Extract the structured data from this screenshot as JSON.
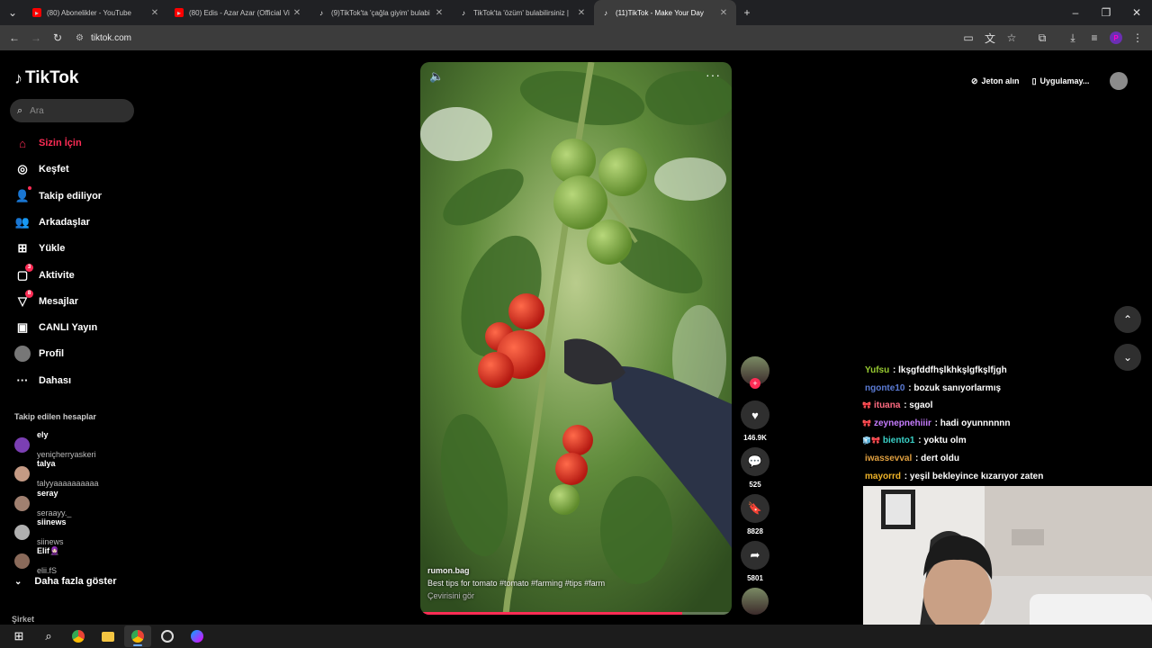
{
  "browser": {
    "tabs": [
      {
        "title": "(80) Abonelikler - YouTube",
        "icon": "youtube-icon",
        "active": false
      },
      {
        "title": "(80) Edis - Azar Azar (Official Vi",
        "icon": "youtube-icon",
        "active": false
      },
      {
        "title": "(9)TikTok'ta 'çağla giyim' bulabi",
        "icon": "tiktok-icon",
        "active": false
      },
      {
        "title": "TikTok'ta 'özüm' bulabilirsiniz |",
        "icon": "tiktok-icon",
        "active": false
      },
      {
        "title": "(11)TikTok - Make Your Day",
        "icon": "tiktok-icon",
        "active": true
      }
    ],
    "url": "tiktok.com",
    "profile_initial": "P"
  },
  "sidebar": {
    "logo": "TikTok",
    "search_placeholder": "Ara",
    "nav": [
      {
        "label": "Sizin İçin",
        "icon": "home-icon",
        "active": true
      },
      {
        "label": "Keşfet",
        "icon": "compass-icon"
      },
      {
        "label": "Takip ediliyor",
        "icon": "following-icon"
      },
      {
        "label": "Arkadaşlar",
        "icon": "friends-icon"
      },
      {
        "label": "Yükle",
        "icon": "upload-icon"
      },
      {
        "label": "Aktivite",
        "icon": "activity-icon",
        "badge": "3"
      },
      {
        "label": "Mesajlar",
        "icon": "messages-icon",
        "badge": "8"
      },
      {
        "label": "CANLI Yayın",
        "icon": "live-icon"
      },
      {
        "label": "Profil",
        "icon": "profile-avatar"
      },
      {
        "label": "Dahası",
        "icon": "more-icon"
      }
    ],
    "following_title": "Takip edilen hesaplar",
    "following": [
      {
        "name": "ely",
        "handle": "yeniçherryaskeri"
      },
      {
        "name": "talya",
        "handle": "talyyaaaaaaaaaa"
      },
      {
        "name": "seray",
        "handle": "seraayy._"
      },
      {
        "name": "siinews",
        "handle": "siinews"
      },
      {
        "name": "Elif🧕🏻",
        "handle": "elii.fS"
      }
    ],
    "show_more": "Daha fazla göster",
    "company": "Şirket"
  },
  "video": {
    "username": "rumon.bag",
    "caption": "Best tips for tomato #tomato #farming #tips #farm",
    "translate": "Çevirisini gör",
    "progress": 0.84
  },
  "actions": {
    "likes": "146.9K",
    "comments": "525",
    "saves": "8828",
    "shares": "5801"
  },
  "topbar": {
    "coins": "Jeton alın",
    "app": "Uygulamay..."
  },
  "chat": [
    {
      "user": "Yufsu",
      "msg": ": lkşgfddfhşlkhkşlgfkşlfjgh",
      "color": "#9acd32",
      "badges": ""
    },
    {
      "user": "ngonte10",
      "msg": ": bozuk sanıyorlarmış",
      "color": "#5b7bd5",
      "badges": ""
    },
    {
      "user": "ituana",
      "msg": ": sgaol",
      "color": "#ff6b81",
      "badges": "🎀"
    },
    {
      "user": "zeynepnehiiir",
      "msg": ": hadi oyunnnnnn",
      "color": "#c77dff",
      "badges": "🎀"
    },
    {
      "user": "biento1",
      "msg": ": yoktu olm",
      "color": "#3ad1c7",
      "badges": "🧊🎀"
    },
    {
      "user": "iwassevval",
      "msg": ": dert oldu",
      "color": "#e0a040",
      "badges": ""
    },
    {
      "user": "mayorrd",
      "msg": ": yeşil bekleyince kızarıyor zaten",
      "color": "#f0b429",
      "badges": ""
    }
  ],
  "colors": {
    "brand": "#fe2c55",
    "surface": "#2f2f2f"
  }
}
